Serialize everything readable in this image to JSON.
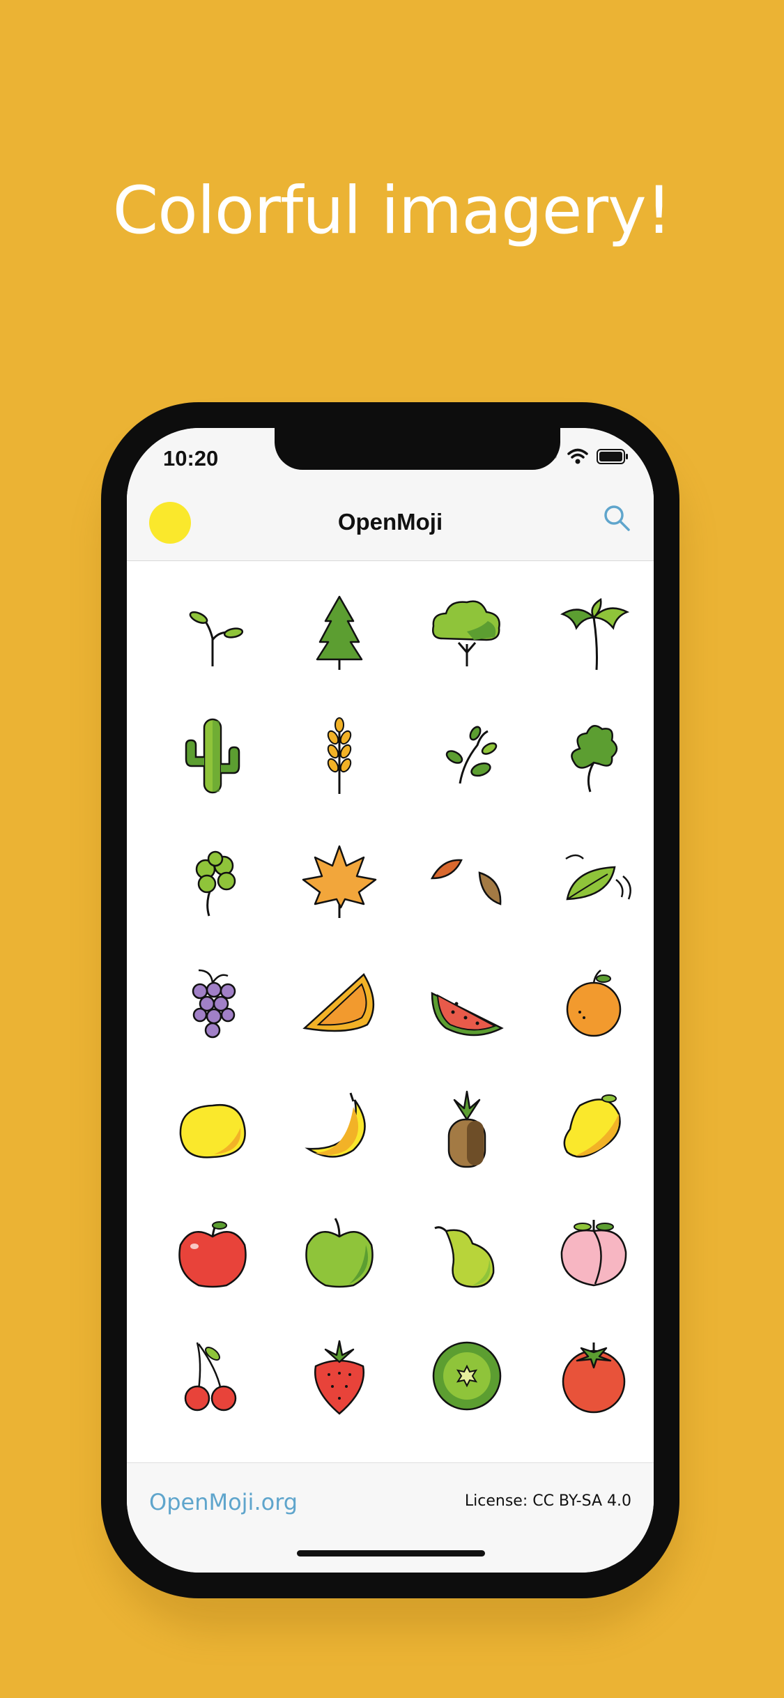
{
  "headline": "Colorful imagery!",
  "status": {
    "time": "10:20"
  },
  "navbar": {
    "title": "OpenMoji",
    "avatar_color": "#FAE82C",
    "search_icon": "search-icon"
  },
  "emoji_grid": [
    "seedling",
    "evergreen-tree",
    "deciduous-tree",
    "palm-tree",
    "cactus",
    "sheaf-of-rice",
    "herb",
    "shamrock",
    "four-leaf-clover",
    "maple-leaf",
    "fallen-leaf",
    "leaf-fluttering-in-wind",
    "grapes",
    "melon",
    "watermelon",
    "tangerine",
    "lemon",
    "banana",
    "pineapple",
    "mango",
    "red-apple",
    "green-apple",
    "pear",
    "peach",
    "cherries",
    "strawberry",
    "kiwi-fruit",
    "tomato"
  ],
  "footer": {
    "link": "OpenMoji.org",
    "license": "License: CC BY-SA 4.0"
  },
  "colors": {
    "background": "#EBB334",
    "link": "#5FA5CC",
    "leaf_green": "#8FC43A",
    "dark_green": "#5C9E31"
  }
}
